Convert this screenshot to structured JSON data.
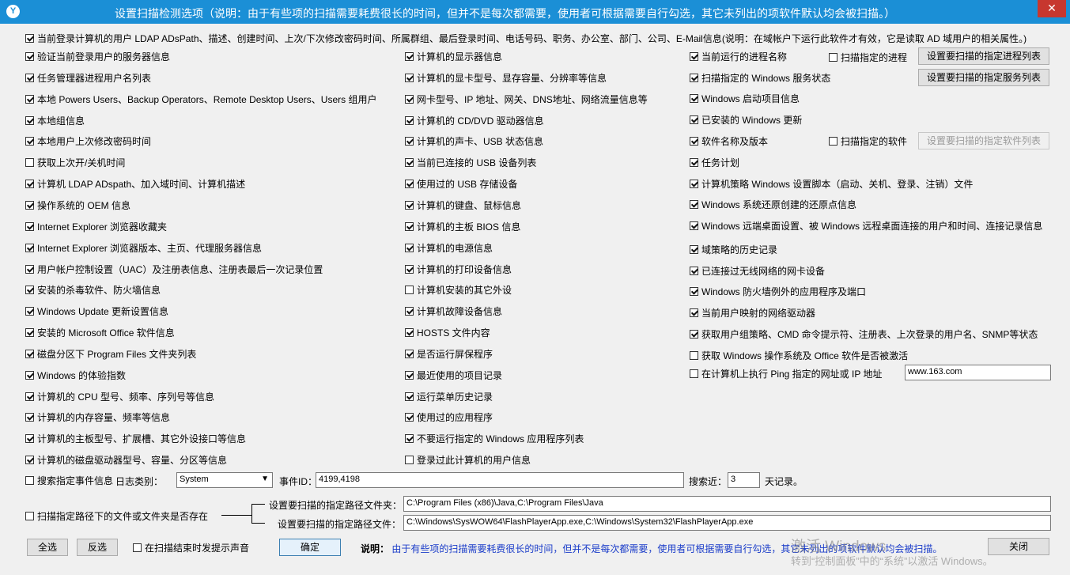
{
  "window": {
    "icon_glyph": "Y",
    "title": "设置扫描检测选项（说明：由于有些项的扫描需要耗费很长的时间，但并不是每次都需要，使用者可根据需要自行勾选，其它未列出的项软件默认均会被扫描。）",
    "close_glyph": "✕"
  },
  "top_option": {
    "label": "当前登录计算机的用户 LDAP ADsPath、描述、创建时间、上次/下次修改密码时间、所属群组、最后登录时间、电话号码、职务、办公室、部门、公司、E-Mail信息(说明：在域帐户下运行此软件才有效，它是读取 AD 域用户的相关属性。)",
    "checked": true
  },
  "col1": [
    {
      "label": "验证当前登录用户的服务器信息",
      "checked": true
    },
    {
      "label": "任务管理器进程用户名列表",
      "checked": true
    },
    {
      "label": "本地 Powers Users、Backup Operators、Remote Desktop Users、Users 组用户",
      "checked": true
    },
    {
      "label": "本地组信息",
      "checked": true
    },
    {
      "label": "本地用户上次修改密码时间",
      "checked": true
    },
    {
      "label": "获取上次开/关机时间",
      "checked": false
    },
    {
      "label": "计算机 LDAP ADspath、加入域时间、计算机描述",
      "checked": true
    },
    {
      "label": "操作系统的 OEM 信息",
      "checked": true
    },
    {
      "label": "Internet Explorer 浏览器收藏夹",
      "checked": true
    },
    {
      "label": "Internet Explorer 浏览器版本、主页、代理服务器信息",
      "checked": true
    },
    {
      "label": "用户帐户控制设置（UAC）及注册表信息、注册表最后一次记录位置",
      "checked": true
    },
    {
      "label": "安装的杀毒软件、防火墙信息",
      "checked": true
    },
    {
      "label": "Windows Update 更新设置信息",
      "checked": true
    },
    {
      "label": "安装的 Microsoft Office 软件信息",
      "checked": true
    },
    {
      "label": "磁盘分区下 Program Files 文件夹列表",
      "checked": true
    },
    {
      "label": "Windows 的体验指数",
      "checked": true
    },
    {
      "label": "计算机的 CPU 型号、频率、序列号等信息",
      "checked": true
    },
    {
      "label": "计算机的内存容量、频率等信息",
      "checked": true
    },
    {
      "label": "计算机的主板型号、扩展槽、其它外设接口等信息",
      "checked": true
    },
    {
      "label": "计算机的磁盘驱动器型号、容量、分区等信息",
      "checked": true
    }
  ],
  "col2": [
    {
      "label": "计算机的显示器信息",
      "checked": true
    },
    {
      "label": "计算机的显卡型号、显存容量、分辨率等信息",
      "checked": true
    },
    {
      "label": "网卡型号、IP 地址、网关、DNS地址、网络流量信息等",
      "checked": true
    },
    {
      "label": "计算机的 CD/DVD 驱动器信息",
      "checked": true
    },
    {
      "label": "计算机的声卡、USB 状态信息",
      "checked": true
    },
    {
      "label": "当前已连接的 USB 设备列表",
      "checked": true
    },
    {
      "label": "使用过的 USB 存储设备",
      "checked": true
    },
    {
      "label": "计算机的键盘、鼠标信息",
      "checked": true
    },
    {
      "label": "计算机的主板 BIOS 信息",
      "checked": true
    },
    {
      "label": "计算机的电源信息",
      "checked": true
    },
    {
      "label": "计算机的打印设备信息",
      "checked": true
    },
    {
      "label": "计算机安装的其它外设",
      "checked": false
    },
    {
      "label": "计算机故障设备信息",
      "checked": true
    },
    {
      "label": "HOSTS 文件内容",
      "checked": true
    },
    {
      "label": "是否运行屏保程序",
      "checked": true
    },
    {
      "label": "最近使用的项目记录",
      "checked": true
    },
    {
      "label": "运行菜单历史记录",
      "checked": true
    },
    {
      "label": "使用过的应用程序",
      "checked": true
    },
    {
      "label": "不要运行指定的 Windows 应用程序列表",
      "checked": true
    },
    {
      "label": "登录过此计算机的用户信息",
      "checked": false
    }
  ],
  "col3": [
    {
      "label": "当前运行的进程名称",
      "checked": true
    },
    {
      "label": "扫描指定的 Windows 服务状态",
      "checked": true
    },
    {
      "label": "Windows 启动项目信息",
      "checked": true
    },
    {
      "label": "已安装的 Windows 更新",
      "checked": true
    },
    {
      "label": "软件名称及版本",
      "checked": true
    },
    {
      "label": "任务计划",
      "checked": true
    },
    {
      "label": "计算机策略 Windows 设置脚本（启动、关机、登录、注销）文件",
      "checked": true
    },
    {
      "label": "Windows 系统还原创建的还原点信息",
      "checked": true
    },
    {
      "label": "Windows 远端桌面设置、被 Windows 远程桌面连接的用户和时间、连接记录信息",
      "checked": true
    },
    {
      "label": "域策略的历史记录",
      "checked": true
    },
    {
      "label": "已连接过无线网络的网卡设备",
      "checked": true
    },
    {
      "label": "Windows 防火墙例外的应用程序及端口",
      "checked": true
    },
    {
      "label": "当前用户映射的网络驱动器",
      "checked": true
    },
    {
      "label": "获取用户组策略、CMD 命令提示符、注册表、上次登录的用户名、SNMP等状态",
      "checked": true
    },
    {
      "label": "获取 Windows 操作系统及 Office 软件是否被激活",
      "checked": false
    },
    {
      "label": "在计算机上执行 Ping 指定的网址或 IP 地址",
      "checked": false
    }
  ],
  "extras": {
    "scan_process": {
      "label": "扫描指定的进程",
      "checked": false
    },
    "scan_software": {
      "label": "扫描指定的软件",
      "checked": false
    },
    "process_list_btn": "设置要扫描的指定进程列表",
    "service_list_btn": "设置要扫描的指定服务列表",
    "software_list_btn": "设置要扫描的指定软件列表",
    "ping_value": "www.163.com"
  },
  "event": {
    "checkbox_label": "搜索指定事件信息",
    "checked": false,
    "log_type_label": "日志类别：",
    "log_type_value": "System",
    "event_id_label": "事件ID：",
    "event_id_value": "4199,4198",
    "recent_label": "搜索近：",
    "recent_value": "3",
    "recent_suffix": "天记录。"
  },
  "path": {
    "checkbox_label": "扫描指定路径下的文件或文件夹是否存在",
    "checked": false,
    "folder_label": "设置要扫描的指定路径文件夹：",
    "folder_value": "C:\\Program Files (x86)\\Java,C:\\Program Files\\Java",
    "file_label": "设置要扫描的指定路径文件：",
    "file_value": "C:\\Windows\\SysWOW64\\FlashPlayerApp.exe,C:\\Windows\\System32\\FlashPlayerApp.exe"
  },
  "footer": {
    "select_all": "全选",
    "invert": "反选",
    "sound_label": "在扫描结束时发提示声音",
    "sound_checked": false,
    "ok": "确定",
    "note_label": "说明：",
    "note_text": "由于有些项的扫描需要耗费很长的时间，但并不是每次都需要，使用者可根据需要自行勾选，其它未列出的项软件默认均会被扫描。",
    "close": "关闭"
  },
  "watermark": {
    "line1": "激活 Windows",
    "line2": "转到“控制面板”中的“系统”以激活 Windows。"
  }
}
